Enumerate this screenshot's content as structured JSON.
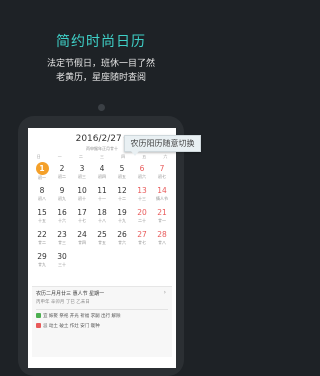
{
  "promo": {
    "headline": "简约时尚日历",
    "line1": "法定节假日，班休一目了然",
    "line2": "老黄历，星座随时查阅"
  },
  "calendar": {
    "selected_date": "2016/2/27",
    "lunar_info": "丙申猴年正月廿十",
    "weekdays": [
      "日",
      "一",
      "二",
      "三",
      "四",
      "五",
      "六"
    ],
    "days": [
      {
        "n": "1",
        "l": "初一",
        "weekend": false,
        "today": true
      },
      {
        "n": "2",
        "l": "初二",
        "weekend": false
      },
      {
        "n": "3",
        "l": "初三",
        "weekend": false
      },
      {
        "n": "4",
        "l": "初四",
        "weekend": false
      },
      {
        "n": "5",
        "l": "初五",
        "weekend": false
      },
      {
        "n": "6",
        "l": "初六",
        "weekend": true
      },
      {
        "n": "7",
        "l": "初七",
        "weekend": true
      },
      {
        "n": "8",
        "l": "初八",
        "weekend": false
      },
      {
        "n": "9",
        "l": "初九",
        "weekend": false
      },
      {
        "n": "10",
        "l": "初十",
        "weekend": false
      },
      {
        "n": "11",
        "l": "十一",
        "weekend": false
      },
      {
        "n": "12",
        "l": "十二",
        "weekend": false
      },
      {
        "n": "13",
        "l": "十三",
        "weekend": true
      },
      {
        "n": "14",
        "l": "情人节",
        "weekend": true
      },
      {
        "n": "15",
        "l": "十五",
        "weekend": false
      },
      {
        "n": "16",
        "l": "十六",
        "weekend": false
      },
      {
        "n": "17",
        "l": "十七",
        "weekend": false
      },
      {
        "n": "18",
        "l": "十八",
        "weekend": false
      },
      {
        "n": "19",
        "l": "十九",
        "weekend": false
      },
      {
        "n": "20",
        "l": "二十",
        "weekend": true
      },
      {
        "n": "21",
        "l": "廿一",
        "weekend": true
      },
      {
        "n": "22",
        "l": "廿二",
        "weekend": false
      },
      {
        "n": "23",
        "l": "廿三",
        "weekend": false
      },
      {
        "n": "24",
        "l": "廿四",
        "weekend": false
      },
      {
        "n": "25",
        "l": "廿五",
        "weekend": false
      },
      {
        "n": "26",
        "l": "廿六",
        "weekend": false
      },
      {
        "n": "27",
        "l": "廿七",
        "weekend": true
      },
      {
        "n": "28",
        "l": "廿八",
        "weekend": true
      },
      {
        "n": "29",
        "l": "廿九",
        "weekend": false
      },
      {
        "n": "30",
        "l": "三十",
        "weekend": false
      }
    ]
  },
  "tooltip": "农历阳历随意切换",
  "info": {
    "title": "农历二月月廿三  惠人节  星期一",
    "detail": "丙申年 辛卯月 丁巳 乙未日",
    "yi": "宜 嫁娶 祭祀 开光 祈福 求嗣 出行 解除",
    "ji": "忌 动土 破土 作灶 安门 栽种"
  }
}
